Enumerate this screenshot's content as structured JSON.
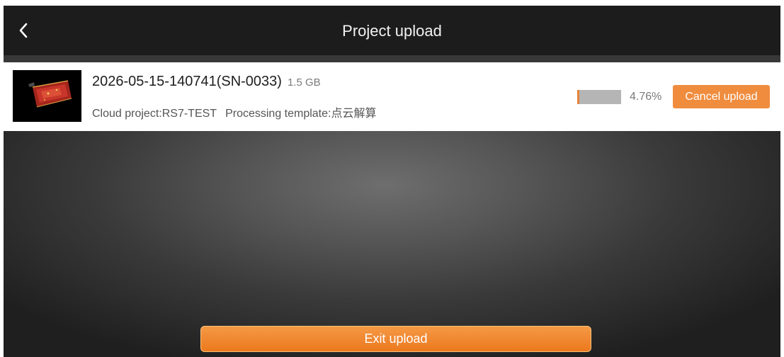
{
  "header": {
    "title": "Project upload",
    "back_icon": "chevron-left-icon"
  },
  "upload_item": {
    "name": "2026-05-15-140741(SN-0033)",
    "size": "1.5 GB",
    "cloud_project": "Cloud project:RS7-TEST",
    "processing_template": "Processing template:点云解算",
    "progress": 0.0476,
    "progress_text": "4.76%",
    "cancel_label": "Cancel upload"
  },
  "footer": {
    "exit_label": "Exit upload"
  },
  "colors": {
    "accent": "#F08C3E",
    "header_bg": "#1C1C1C",
    "progress_track": "#B5B5B5"
  }
}
